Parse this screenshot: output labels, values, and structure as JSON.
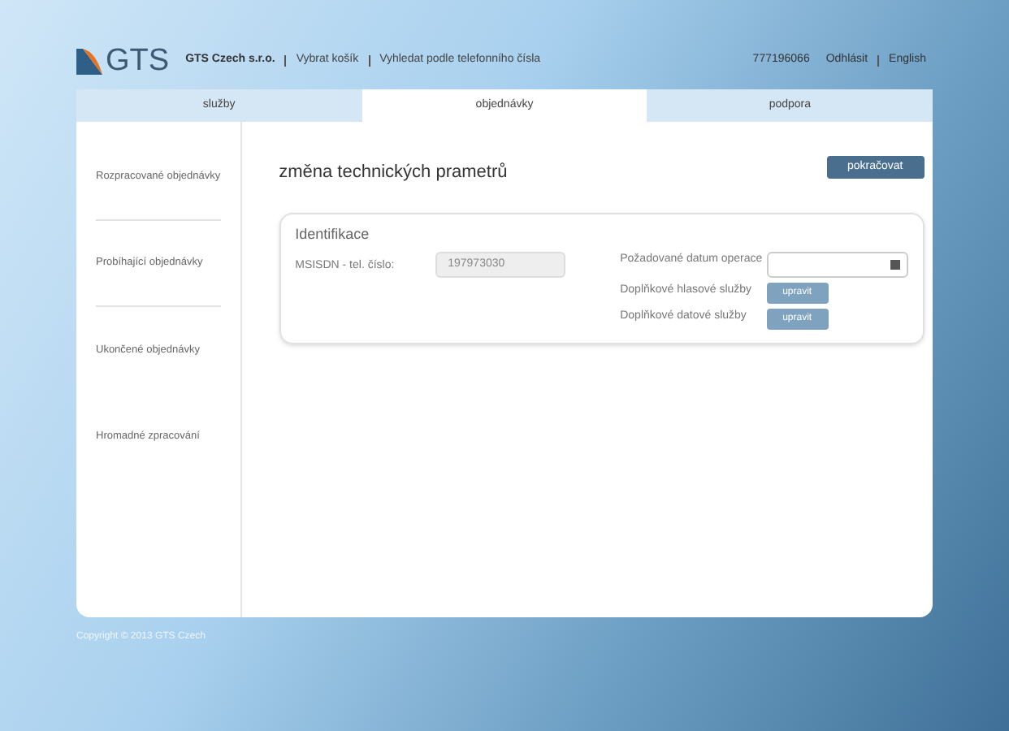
{
  "header": {
    "logo_text": "GTS",
    "company": "GTS Czech s.r.o.",
    "links": [
      "Vybrat košík",
      "Vyhledat podle telefonního čísla"
    ],
    "phone": "777196066",
    "logout": "Odhlásit",
    "language": "English"
  },
  "tabs": [
    {
      "label": "služby",
      "selected": false
    },
    {
      "label": "objednávky",
      "selected": true
    },
    {
      "label": "podpora",
      "selected": false
    }
  ],
  "sidebar": {
    "items": [
      {
        "label": "Rozpracované objednávky",
        "selected": false
      },
      {
        "label": "Probíhající objednávky",
        "selected": false
      },
      {
        "label": "Ukončené objednávky",
        "selected": false
      },
      {
        "label": "Hromadné zpracování",
        "selected": false
      }
    ]
  },
  "main": {
    "title": "změna technických prametrů",
    "continue_button": "pokračovat",
    "section": {
      "title": "Identifikace",
      "msisdn_label": "MSISDN - tel. číslo:",
      "msisdn_value": "197973030",
      "date_label": "Požadované datum operace",
      "voice_label": "Doplňkové hlasové služby",
      "voice_button": "upravit",
      "data_label": "Doplňkové datové služby",
      "data_button": "upravit"
    }
  },
  "footer": "Copyright © 2013 GTS Czech"
}
